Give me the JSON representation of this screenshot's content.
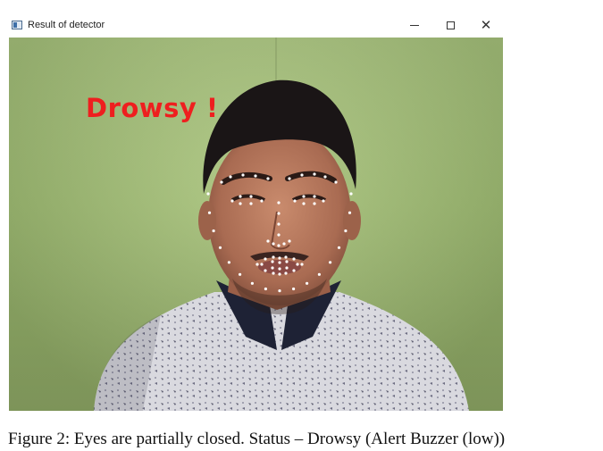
{
  "window": {
    "title": "Result of detector",
    "minimize_icon": "minimize-icon",
    "maximize_icon": "maximize-icon",
    "close_icon": "close-icon",
    "close_glyph": "✕"
  },
  "video": {
    "status_text": "Drowsy !",
    "status_color": "#ee1f1f",
    "landmark_color": "#ffffff",
    "landmark_count": 68
  },
  "caption": {
    "text": "Figure 2: Eyes are partially closed. Status – Drowsy (Alert Buzzer (low))"
  }
}
